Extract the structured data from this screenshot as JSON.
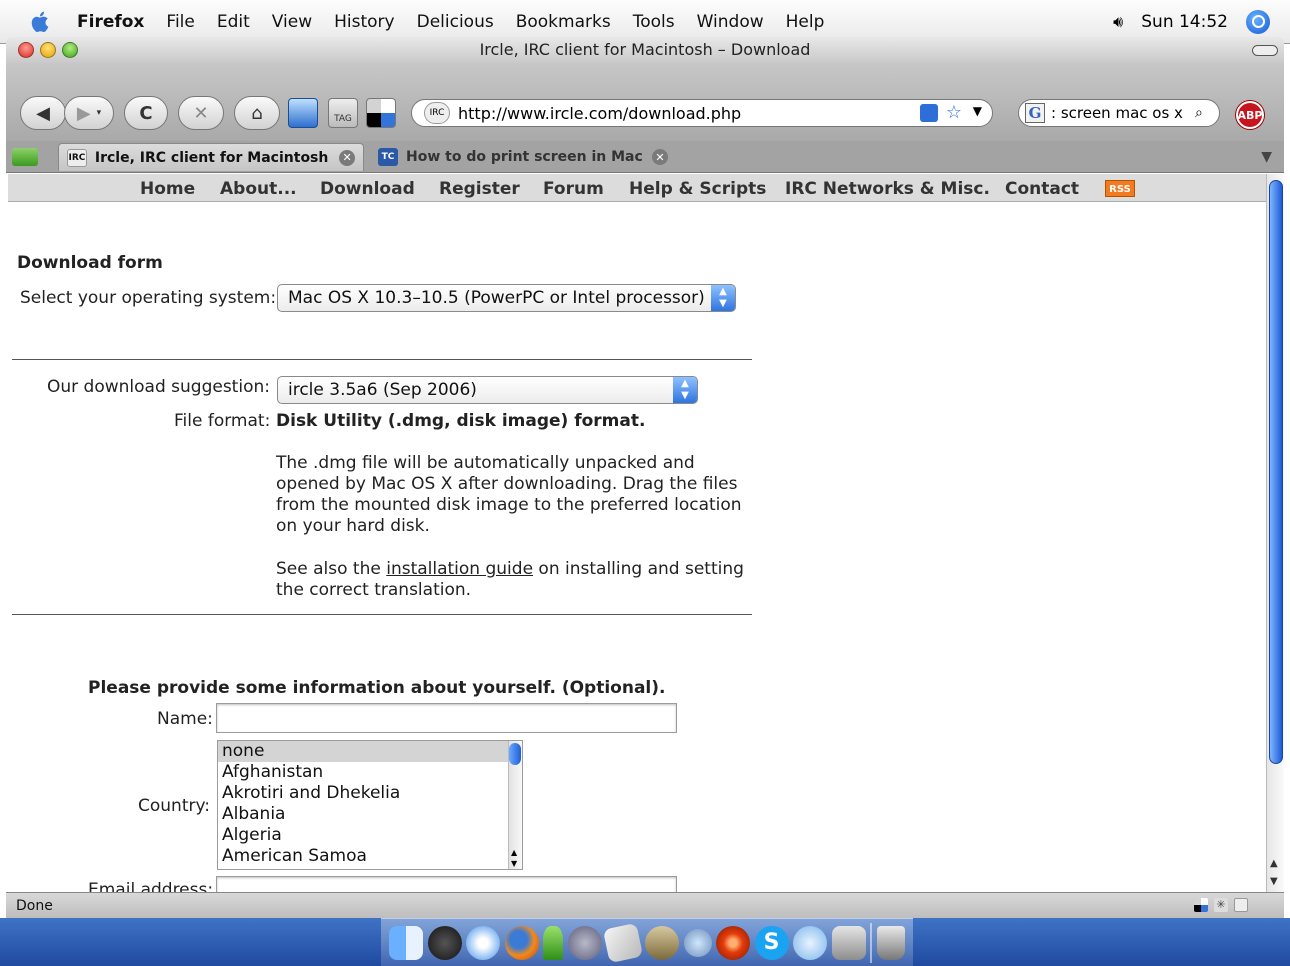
{
  "menubar": {
    "app_name": "Firefox",
    "items": [
      "File",
      "Edit",
      "View",
      "History",
      "Delicious",
      "Bookmarks",
      "Tools",
      "Window",
      "Help"
    ],
    "clock": "Sun 14:52"
  },
  "window": {
    "title": "Ircle, IRC client for Macintosh – Download"
  },
  "toolbar": {
    "url": "http://www.ircle.com/download.php",
    "search_value": ": screen mac os x",
    "search_engine": "G",
    "tag_label": "TAG",
    "abp_label": "ABP"
  },
  "tabs": [
    {
      "title": "Ircle, IRC client for Macintosh -...",
      "active": true,
      "favicon": "irc-icon"
    },
    {
      "title": "How to do print screen in Mac ...",
      "active": false,
      "favicon": "tc-icon"
    }
  ],
  "site_nav": {
    "items": [
      "Home",
      "About...",
      "Download",
      "Register",
      "Forum",
      "Help & Scripts",
      "IRC Networks & Misc.",
      "Contact"
    ],
    "rss_label": "RSS"
  },
  "download": {
    "heading": "Download form",
    "os_label": "Select your operating system:",
    "os_selected": "Mac OS X 10.3–10.5 (PowerPC or Intel processor)",
    "suggestion_label": "Our download suggestion:",
    "suggestion_selected": "ircle 3.5a6 (Sep 2006)",
    "format_label": "File format:",
    "format_value": "Disk Utility (.dmg, disk image) format.",
    "desc1": "The .dmg file will be automatically unpacked and opened by Mac OS X after downloading. Drag the files from the mounted disk image to the preferred location on your hard disk.",
    "desc2_prefix": "See also the ",
    "desc2_link": "installation guide",
    "desc2_suffix": " on installing and setting the correct translation."
  },
  "info": {
    "heading": "Please provide some information about yourself. (Optional).",
    "name_label": "Name:",
    "name_value": "",
    "country_label": "Country:",
    "countries": [
      "none",
      "Afghanistan",
      "Akrotiri and Dhekelia",
      "Albania",
      "Algeria",
      "American Samoa"
    ],
    "email_label": "Email address:"
  },
  "status": {
    "text": "Done"
  },
  "colors": {
    "accent": "#2f73e0",
    "rss": "#f47a1f",
    "abp": "#c8141c"
  }
}
